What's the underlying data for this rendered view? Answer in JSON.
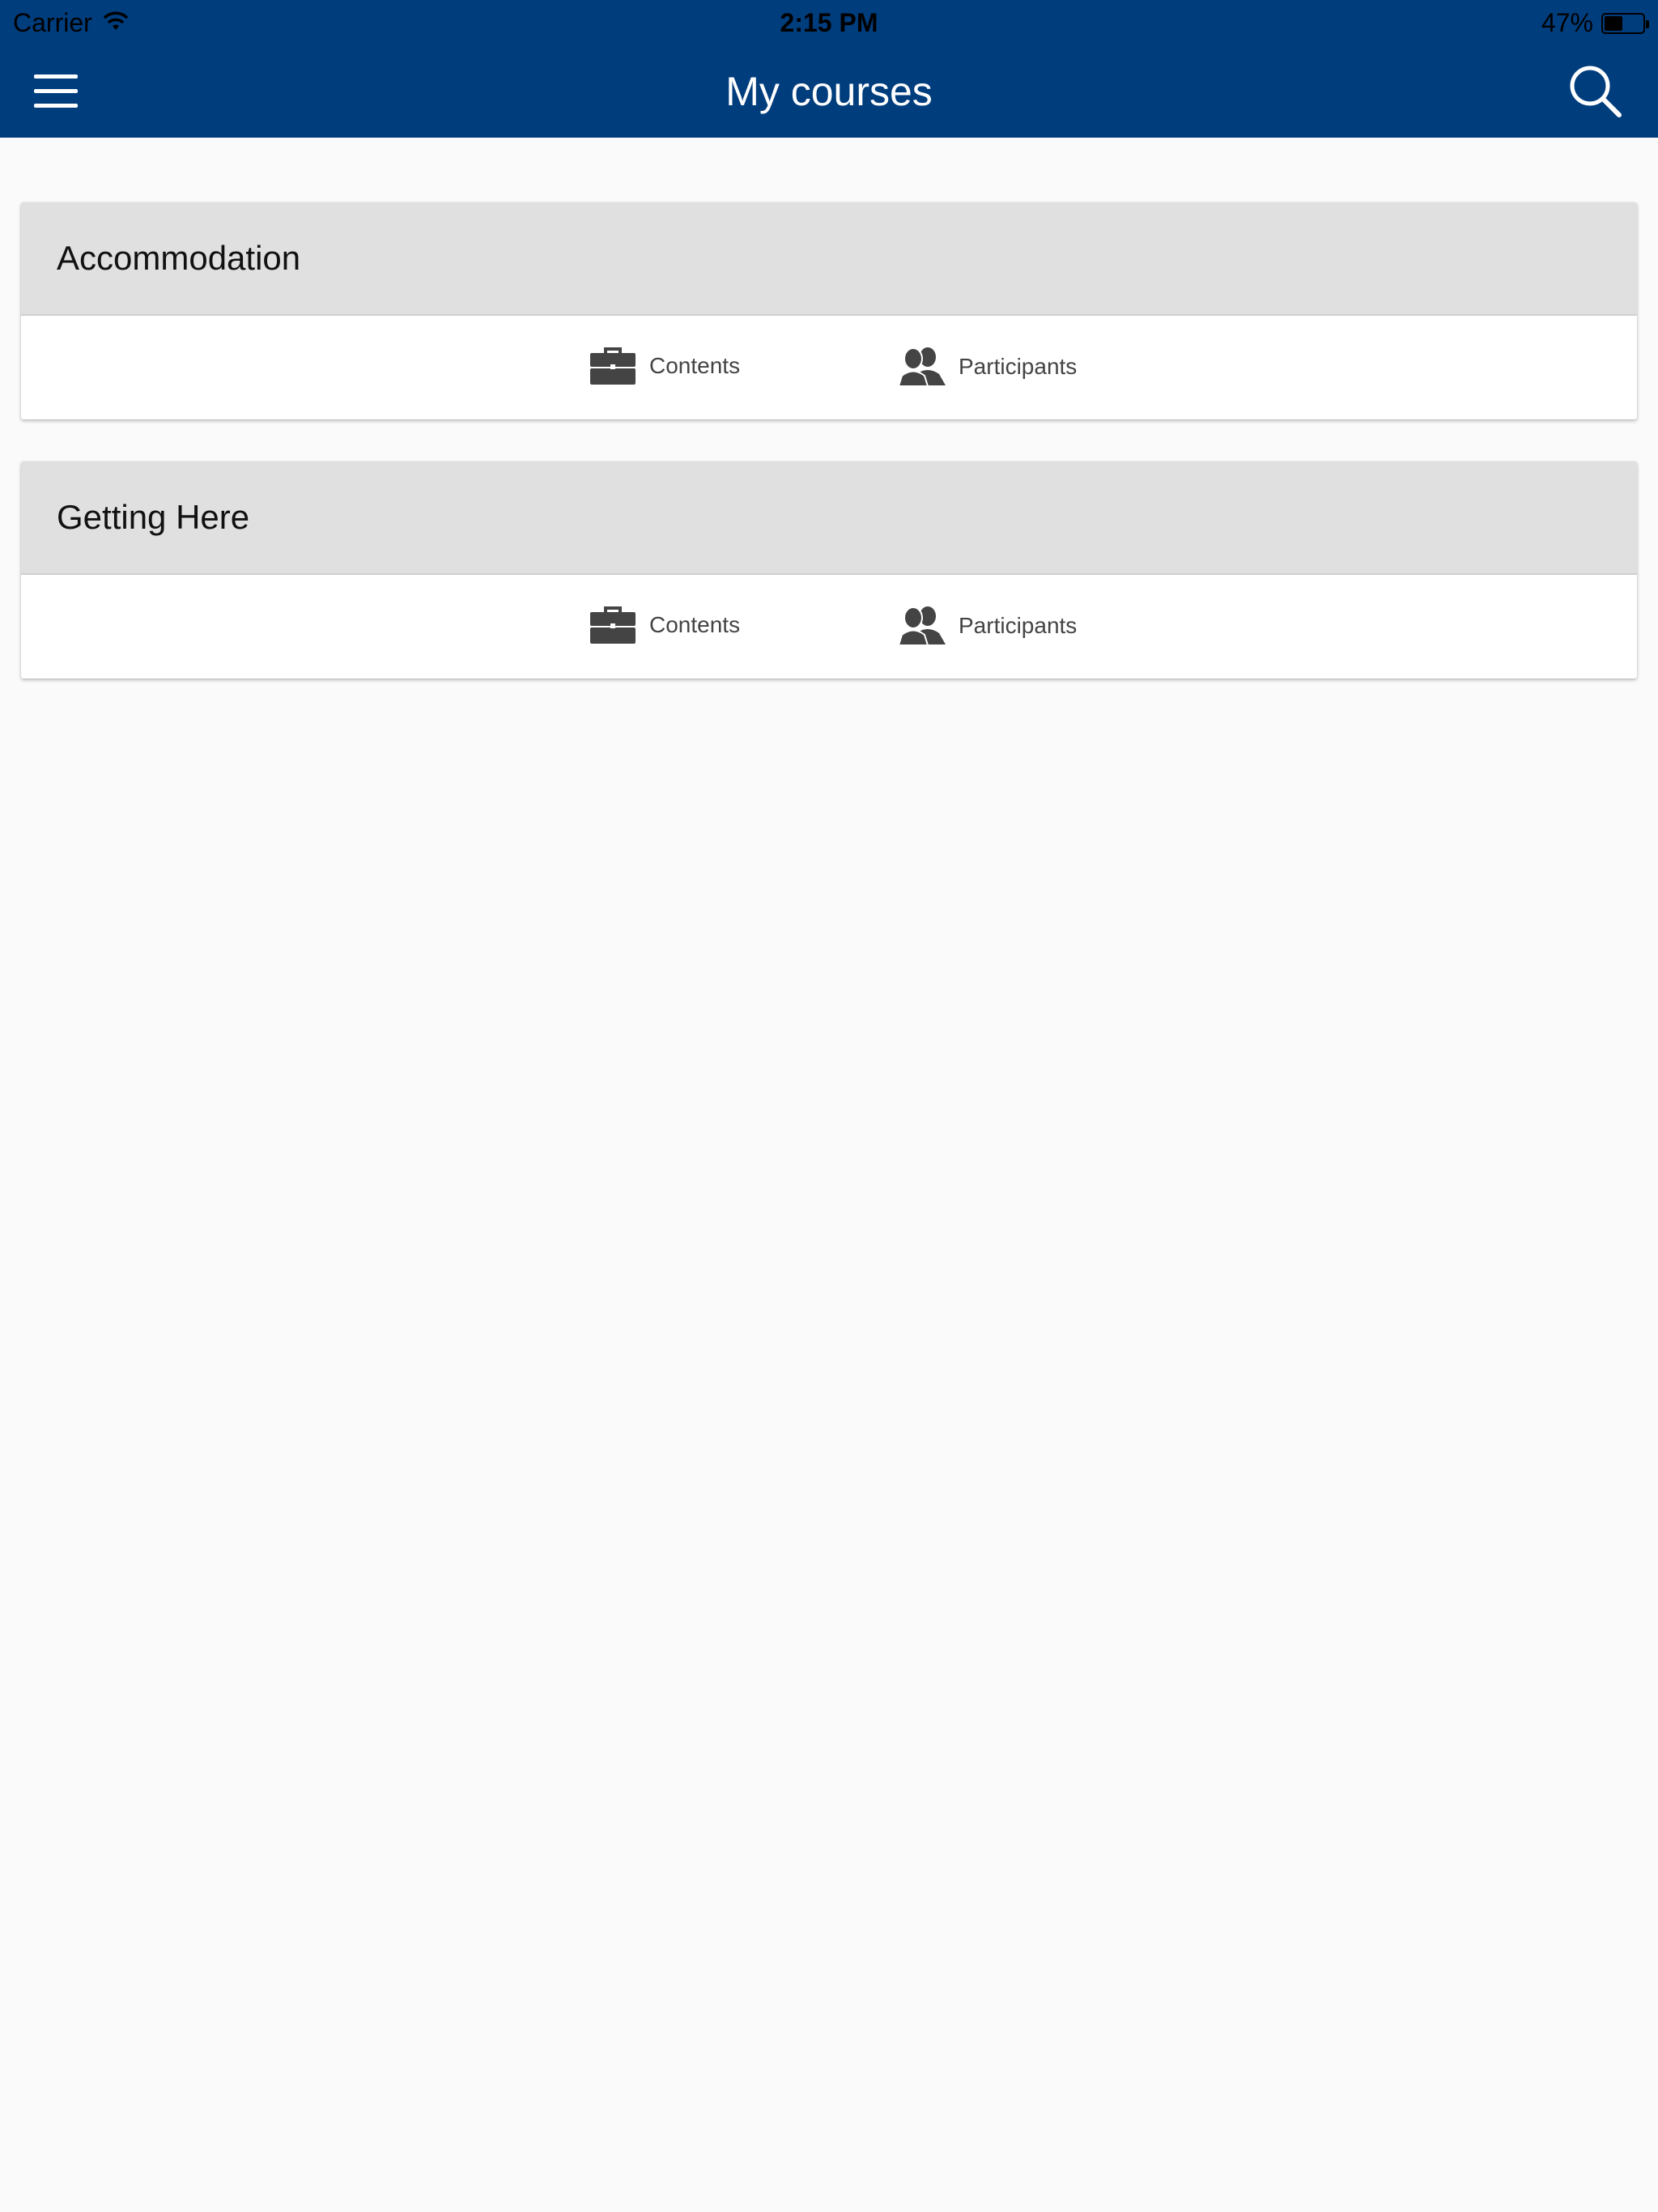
{
  "status_bar": {
    "carrier": "Carrier",
    "time": "2:15 PM",
    "battery_percent": "47%",
    "battery_level": 0.47
  },
  "header": {
    "title": "My courses",
    "menu_icon": "hamburger-menu-icon",
    "search_icon": "search-icon"
  },
  "colors": {
    "nav_background": "#003d7d",
    "page_background": "#fafafa",
    "card_header": "#e0e0e0",
    "icon": "#444444"
  },
  "courses": [
    {
      "name": "Accommodation",
      "actions": [
        {
          "label": "Contents",
          "icon": "briefcase-icon"
        },
        {
          "label": "Participants",
          "icon": "users-icon"
        }
      ]
    },
    {
      "name": "Getting Here",
      "actions": [
        {
          "label": "Contents",
          "icon": "briefcase-icon"
        },
        {
          "label": "Participants",
          "icon": "users-icon"
        }
      ]
    }
  ]
}
